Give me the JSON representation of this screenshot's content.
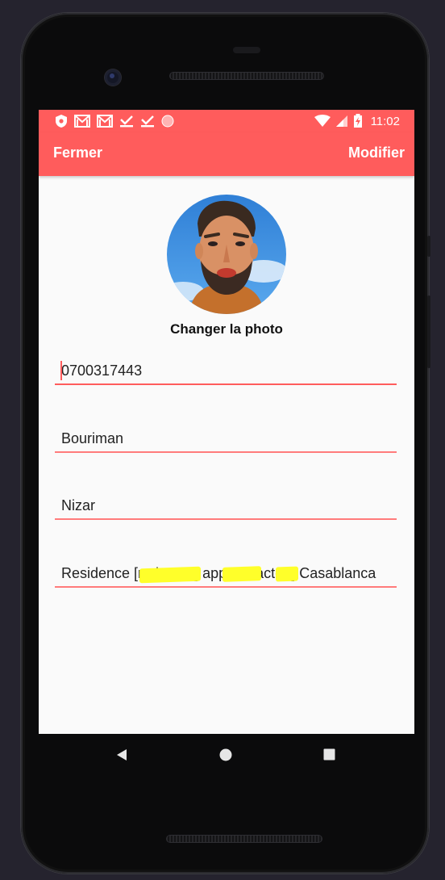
{
  "status_bar": {
    "time": "11:02",
    "left_icons": [
      "shield-icon",
      "gmail-icon",
      "gmail-icon",
      "download-done-icon",
      "download-done-icon",
      "record-dot-icon"
    ],
    "right_icons": [
      "wifi-icon",
      "cell-signal-icon",
      "battery-charging-icon"
    ]
  },
  "app_bar": {
    "close_label": "Fermer",
    "edit_label": "Modifier",
    "accent_color": "#ff5c5c"
  },
  "profile": {
    "change_photo_label": "Changer la photo"
  },
  "form": {
    "phone": "0700317443",
    "last_name": "Bouriman",
    "first_name": "Nizar",
    "address": "Residence [redacted] app [redacted] Casablanca"
  },
  "nav_bar": {
    "icons": [
      "back-icon",
      "home-icon",
      "recents-icon"
    ]
  }
}
